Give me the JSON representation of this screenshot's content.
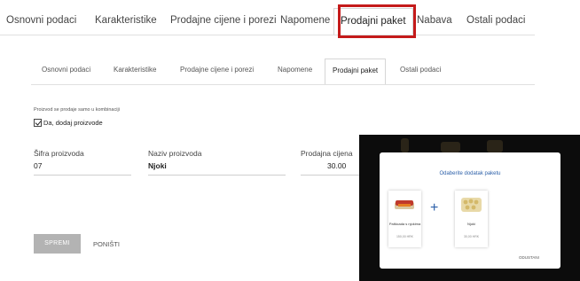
{
  "main_tabs": [
    "Osnovni podaci",
    "Karakteristike",
    "Prodajne cijene i porezi",
    "Napomene",
    "Prodajni paket",
    "Nabava",
    "Ostali podaci"
  ],
  "sub_tabs": [
    "Osnovni podaci",
    "Karakteristike",
    "Prodajne cijene i porezi",
    "Napomene",
    "Prodajni paket",
    "Ostali podaci"
  ],
  "combination": {
    "label": "Proizvod se prodaje samo u kombinaciji",
    "checkbox_label": "Da, dodaj proizvode",
    "checked": true
  },
  "fields": {
    "code_label": "Šifra proizvoda",
    "code_value": "07",
    "name_label": "Naziv proizvoda",
    "name_value": "Njoki",
    "price_label": "Prodajna cijena",
    "price_value": "30.00"
  },
  "buttons": {
    "save": "SPREMI",
    "cancel": "PONIŠTI"
  },
  "modal": {
    "title": "Odaberite dodatak paketu",
    "items": [
      {
        "name": "Palšicada s njokima",
        "price": "150,00 HRK"
      },
      {
        "name": "Njoki",
        "price": "30,00 HRK"
      }
    ],
    "cancel": "ODUSTANI"
  },
  "colors": {
    "highlight": "#c41a1a",
    "accent": "#2b5fa8"
  }
}
